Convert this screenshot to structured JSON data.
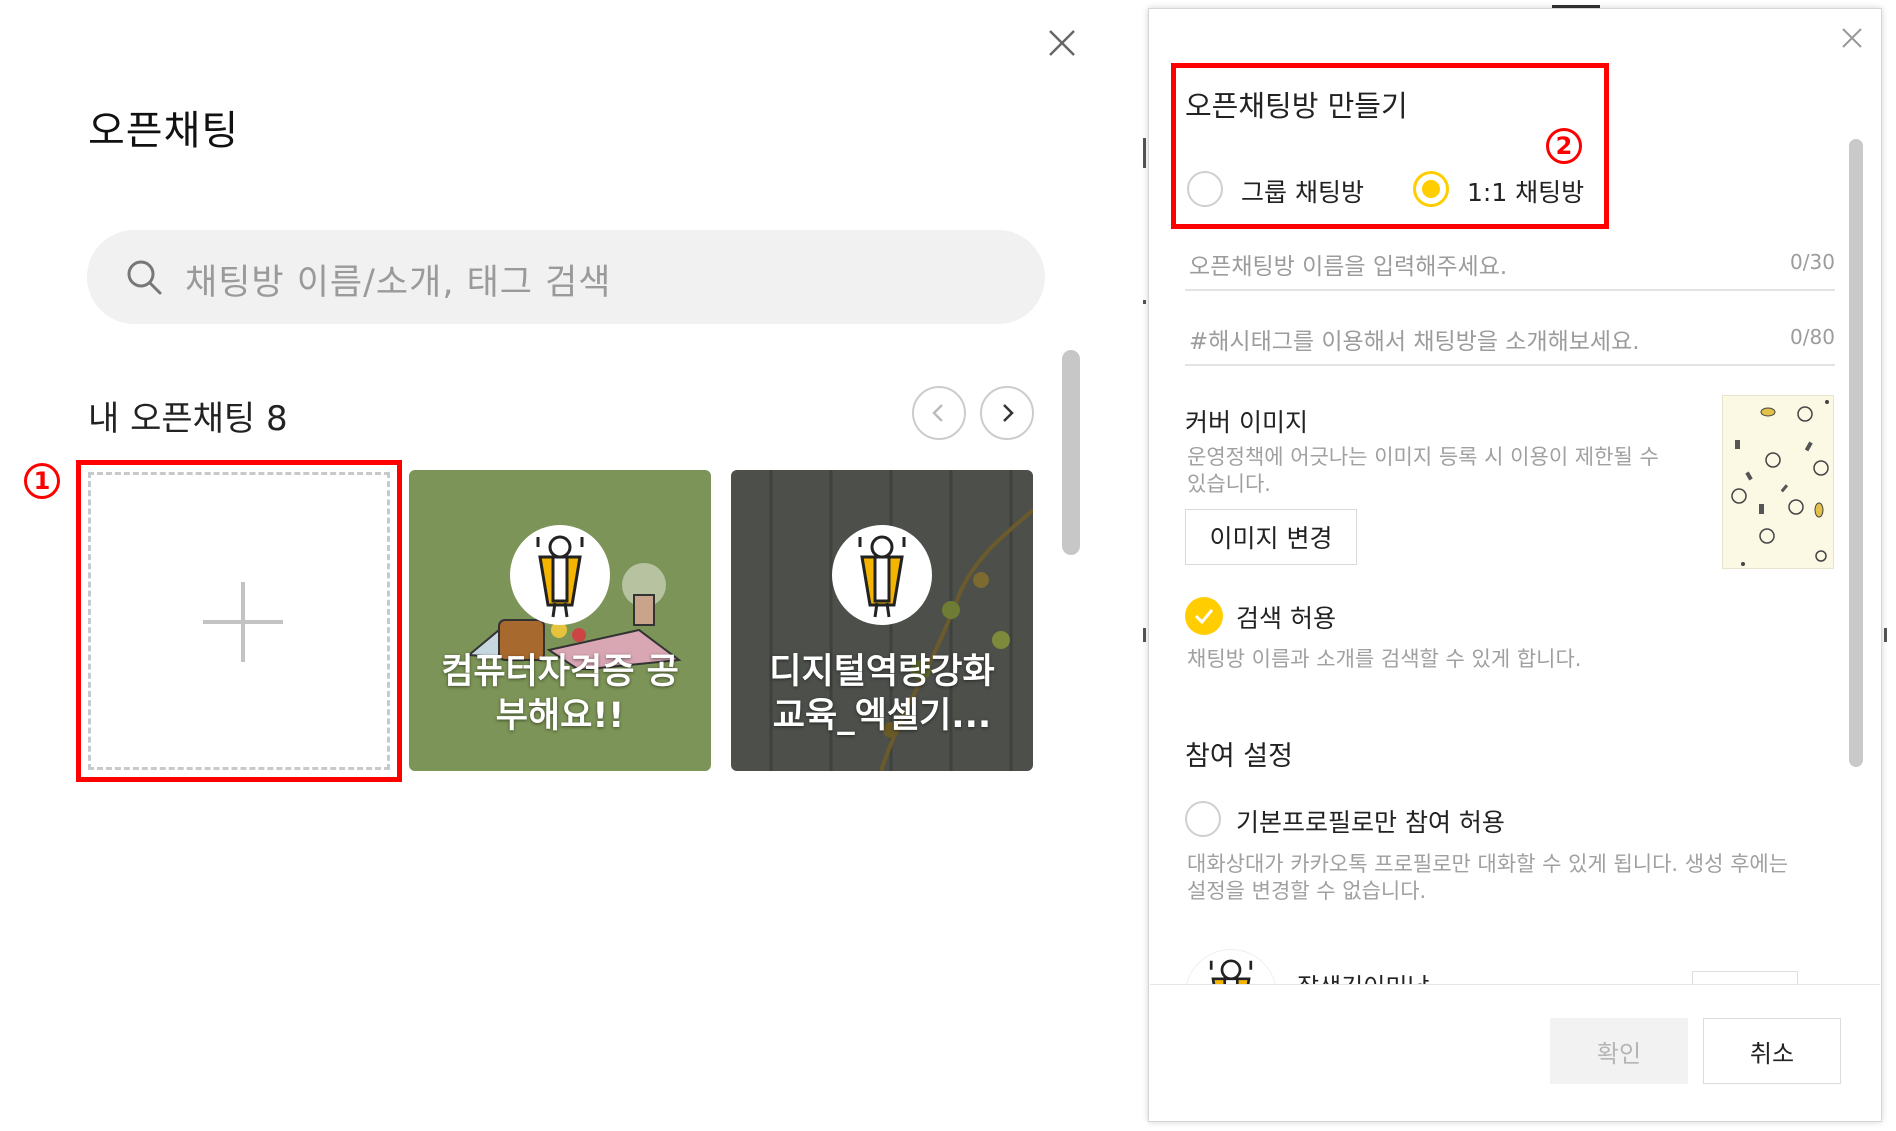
{
  "left_panel": {
    "title": "오픈채팅",
    "search": {
      "placeholder": "채팅방 이름/소개, 태그 검색"
    },
    "my_section": {
      "title": "내 오픈채팅 8"
    },
    "rooms": [
      {
        "title_line1": "컴퓨터자격증 공",
        "title_line2": "부해요!!",
        "bg_color": "#7c9457"
      },
      {
        "title_line1": "디지털역량강화",
        "title_line2": "교육_엑셀기...",
        "bg_color": "#4c4f4a"
      }
    ]
  },
  "annotations": {
    "step1": "1",
    "step2": "2",
    "highlight_color": "#ff0000"
  },
  "dialog": {
    "title": "오픈채팅방 만들기",
    "room_types": {
      "group": "그룹 채팅방",
      "one_to_one": "1:1 채팅방",
      "selected": "one_to_one"
    },
    "name_input": {
      "placeholder": "오픈채팅방 이름을 입력해주세요.",
      "counter": "0/30"
    },
    "hashtag_input": {
      "placeholder": "#해시태그를 이용해서 채팅방을 소개해보세요.",
      "counter": "0/80"
    },
    "cover": {
      "title": "커버 이미지",
      "help_line1": "운영정책에 어긋나는 이미지 등록 시 이용이 제한될 수",
      "help_line2": "있습니다.",
      "change_button": "이미지 변경"
    },
    "search_allow": {
      "label": "검색 허용",
      "checked": true,
      "help": "채팅방 이름과 소개를 검색할 수 있게 합니다."
    },
    "participation": {
      "title": "참여 설정",
      "default_profile_only": "기본프로필로만 참여 허용",
      "help_line1": "대화상대가 카카오톡 프로필로만 대화할 수 있게 됩니다. 생성 후에는",
      "help_line2": "설정을 변경할 수 없습니다.",
      "profile_name": "잘생긴이미남"
    },
    "buttons": {
      "confirm": "확인",
      "cancel": "취소"
    },
    "accent_color": "#ffcd00"
  }
}
